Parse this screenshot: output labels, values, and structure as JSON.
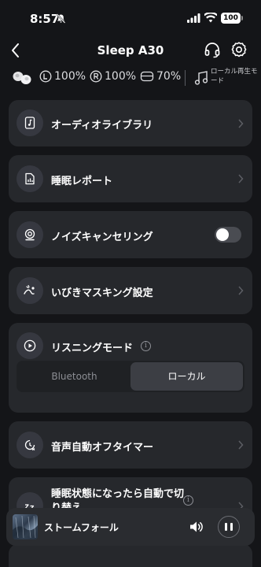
{
  "status_bar": {
    "time": "8:57",
    "battery": "100"
  },
  "header": {
    "title": "Sleep A30"
  },
  "device_info": {
    "left_battery": "100%",
    "right_battery": "100%",
    "case_battery": "70%",
    "local_playback_label": "ローカル再生モード"
  },
  "menu": {
    "audio_library": "オーディオライブラリ",
    "sleep_report": "睡眠レポート",
    "noise_cancelling": "ノイズキャンセリング",
    "noise_cancelling_on": false,
    "snore_masking": "いびきマスキング設定",
    "listening_mode": {
      "label": "リスニングモード",
      "options": [
        "Bluetooth",
        "ローカル"
      ],
      "selected": "ローカル"
    },
    "audio_off_timer": "音声自動オフタイマー",
    "auto_on_sleep": "睡眠状態になったら自動で切り替え"
  },
  "player": {
    "track": "ストームフォール"
  },
  "colors": {
    "background": "#141518",
    "card": "#26282c",
    "segment_active": "#3c3e44"
  }
}
